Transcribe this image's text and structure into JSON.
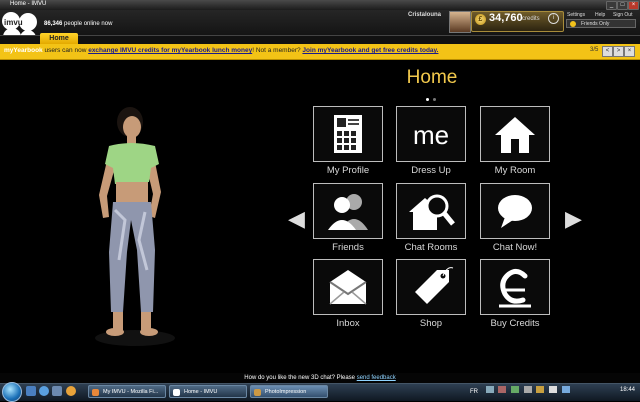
{
  "window": {
    "title": "Home - IMVU"
  },
  "header": {
    "logo_text": "imvu",
    "online_count": "86,346",
    "online_text": "people online now",
    "username": "Cristalouna",
    "credits_value": "34,760",
    "credits_label": "credits",
    "links": [
      "Settings",
      "Help",
      "Sign Out"
    ],
    "presence": "Friends Only"
  },
  "tabs": [
    {
      "label": "Home"
    }
  ],
  "promo": {
    "brand": "myYearbook",
    "text1": " users can now ",
    "link1": "exchange IMVU credits for myYearbook lunch money",
    "text2": "! Not a member? ",
    "link2": "Join myYearbook and get free credits today.",
    "pager": "3/5"
  },
  "main": {
    "title": "Home",
    "tiles": [
      {
        "label": "My Profile",
        "icon": "profile-icon"
      },
      {
        "label": "Dress Up",
        "icon": "me-icon",
        "icon_text": "me"
      },
      {
        "label": "My Room",
        "icon": "house-icon"
      },
      {
        "label": "Friends",
        "icon": "friends-icon"
      },
      {
        "label": "Chat Rooms",
        "icon": "chat-rooms-icon"
      },
      {
        "label": "Chat Now!",
        "icon": "speech-bubble-icon"
      },
      {
        "label": "Inbox",
        "icon": "envelope-icon"
      },
      {
        "label": "Shop",
        "icon": "tag-icon"
      },
      {
        "label": "Buy Credits",
        "icon": "credits-icon"
      }
    ]
  },
  "status": {
    "text": "How do you like the new 3D chat? Please ",
    "link": "send feedback"
  },
  "taskbar": {
    "tasks": [
      "My IMVU - Mozilla Fi...",
      "Home - IMVU",
      "PhotoImpression"
    ],
    "lang": "FR",
    "clock": "18:44"
  },
  "colors": {
    "accent_yellow": "#f3c316",
    "title_gold": "#f2c94c"
  }
}
